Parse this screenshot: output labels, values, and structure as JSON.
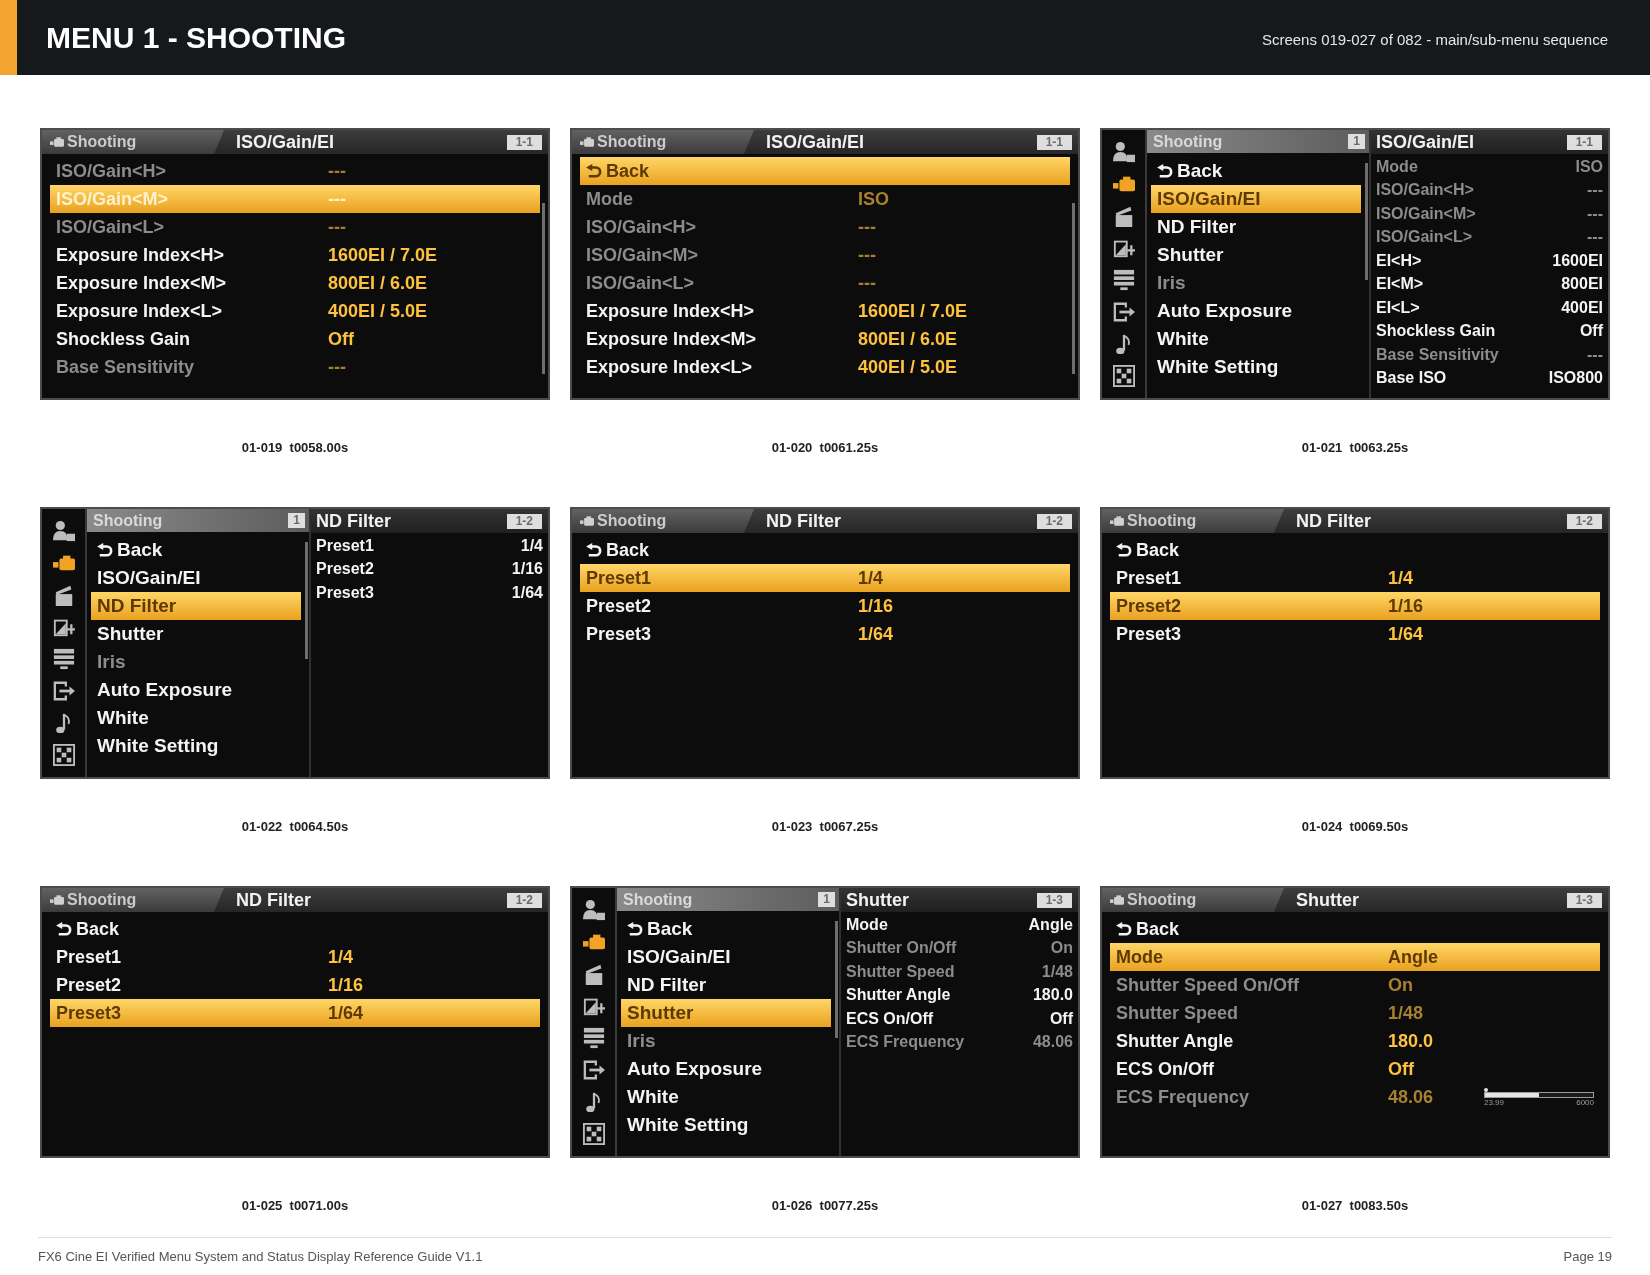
{
  "header": {
    "title": "MENU 1 - SHOOTING",
    "subtitle": "Screens 019-027 of 082 - main/sub-menu sequence"
  },
  "screens": [
    {
      "kind": "list",
      "tab": "Shooting",
      "title": "ISO/Gain/EI",
      "page": "1-1",
      "scrollbar": true,
      "rows": [
        {
          "kind": "setting",
          "label": "ISO/Gain<H>",
          "value": "---",
          "selected": false,
          "disabled": true
        },
        {
          "kind": "setting",
          "label": "ISO/Gain<M>",
          "value": "---",
          "selected": true,
          "disabled": true
        },
        {
          "kind": "setting",
          "label": "ISO/Gain<L>",
          "value": "---",
          "selected": false,
          "disabled": true
        },
        {
          "kind": "setting",
          "label": "Exposure Index<H>",
          "value": "1600EI / 7.0E",
          "selected": false,
          "disabled": false
        },
        {
          "kind": "setting",
          "label": "Exposure Index<M>",
          "value": "800EI / 6.0E",
          "selected": false,
          "disabled": false
        },
        {
          "kind": "setting",
          "label": "Exposure Index<L>",
          "value": "400EI / 5.0E",
          "selected": false,
          "disabled": false
        },
        {
          "kind": "setting",
          "label": "Shockless Gain",
          "value": "Off",
          "selected": false,
          "disabled": false
        },
        {
          "kind": "setting",
          "label": "Base Sensitivity",
          "value": "---",
          "selected": false,
          "disabled": true
        }
      ],
      "caption": "01-019  t0058.00s"
    },
    {
      "kind": "list",
      "tab": "Shooting",
      "title": "ISO/Gain/EI",
      "page": "1-1",
      "scrollbar": true,
      "rows": [
        {
          "kind": "back",
          "label": "Back",
          "selected": true,
          "disabled": false
        },
        {
          "kind": "setting",
          "label": "Mode",
          "value": "ISO",
          "selected": false,
          "disabled": true
        },
        {
          "kind": "setting",
          "label": "ISO/Gain<H>",
          "value": "---",
          "selected": false,
          "disabled": true
        },
        {
          "kind": "setting",
          "label": "ISO/Gain<M>",
          "value": "---",
          "selected": false,
          "disabled": true
        },
        {
          "kind": "setting",
          "label": "ISO/Gain<L>",
          "value": "---",
          "selected": false,
          "disabled": true
        },
        {
          "kind": "setting",
          "label": "Exposure Index<H>",
          "value": "1600EI / 7.0E",
          "selected": false,
          "disabled": false
        },
        {
          "kind": "setting",
          "label": "Exposure Index<M>",
          "value": "800EI / 6.0E",
          "selected": false,
          "disabled": false
        },
        {
          "kind": "setting",
          "label": "Exposure Index<L>",
          "value": "400EI / 5.0E",
          "selected": false,
          "disabled": false
        }
      ],
      "caption": "01-020  t0061.25s"
    },
    {
      "kind": "split",
      "menu": {
        "title": "Shooting",
        "page": "1",
        "scrollbar": true,
        "categories": [
          {
            "selected": false
          },
          {
            "selected": true
          },
          {
            "selected": false
          },
          {
            "selected": false
          },
          {
            "selected": false
          },
          {
            "selected": false
          },
          {
            "selected": false
          },
          {
            "selected": false
          }
        ],
        "items": [
          {
            "kind": "back",
            "label": "Back",
            "selected": false,
            "disabled": false
          },
          {
            "kind": "setting",
            "label": "ISO/Gain/EI",
            "selected": true,
            "disabled": false
          },
          {
            "kind": "setting",
            "label": "ND Filter",
            "selected": false,
            "disabled": false
          },
          {
            "kind": "setting",
            "label": "Shutter",
            "selected": false,
            "disabled": false
          },
          {
            "kind": "setting",
            "label": "Iris",
            "selected": false,
            "disabled": true
          },
          {
            "kind": "setting",
            "label": "Auto Exposure",
            "selected": false,
            "disabled": false
          },
          {
            "kind": "setting",
            "label": "White",
            "selected": false,
            "disabled": false
          },
          {
            "kind": "setting",
            "label": "White Setting",
            "selected": false,
            "disabled": false
          }
        ]
      },
      "pane": {
        "title": "ISO/Gain/EI",
        "page": "1-1",
        "rows": [
          {
            "kind": "setting",
            "label": "Mode",
            "value": "ISO",
            "selected": false,
            "disabled": true
          },
          {
            "kind": "setting",
            "label": "ISO/Gain<H>",
            "value": "---",
            "selected": false,
            "disabled": true
          },
          {
            "kind": "setting",
            "label": "ISO/Gain<M>",
            "value": "---",
            "selected": false,
            "disabled": true
          },
          {
            "kind": "setting",
            "label": "ISO/Gain<L>",
            "value": "---",
            "selected": false,
            "disabled": true
          },
          {
            "kind": "setting",
            "label": "EI<H>",
            "value": "1600EI",
            "selected": false,
            "disabled": false
          },
          {
            "kind": "setting",
            "label": "EI<M>",
            "value": "800EI",
            "selected": false,
            "disabled": false
          },
          {
            "kind": "setting",
            "label": "EI<L>",
            "value": "400EI",
            "selected": false,
            "disabled": false
          },
          {
            "kind": "setting",
            "label": "Shockless Gain",
            "value": "Off",
            "selected": false,
            "disabled": false
          },
          {
            "kind": "setting",
            "label": "Base Sensitivity",
            "value": "---",
            "selected": false,
            "disabled": true
          },
          {
            "kind": "setting",
            "label": "Base ISO",
            "value": "ISO800",
            "selected": false,
            "disabled": false
          }
        ]
      },
      "caption": "01-021  t0063.25s"
    },
    {
      "kind": "split",
      "menu": {
        "title": "Shooting",
        "page": "1",
        "scrollbar": true,
        "categories": [
          {
            "selected": false
          },
          {
            "selected": true
          },
          {
            "selected": false
          },
          {
            "selected": false
          },
          {
            "selected": false
          },
          {
            "selected": false
          },
          {
            "selected": false
          },
          {
            "selected": false
          }
        ],
        "items": [
          {
            "kind": "back",
            "label": "Back",
            "selected": false,
            "disabled": false
          },
          {
            "kind": "setting",
            "label": "ISO/Gain/EI",
            "selected": false,
            "disabled": false
          },
          {
            "kind": "setting",
            "label": "ND Filter",
            "selected": true,
            "disabled": false
          },
          {
            "kind": "setting",
            "label": "Shutter",
            "selected": false,
            "disabled": false
          },
          {
            "kind": "setting",
            "label": "Iris",
            "selected": false,
            "disabled": true
          },
          {
            "kind": "setting",
            "label": "Auto Exposure",
            "selected": false,
            "disabled": false
          },
          {
            "kind": "setting",
            "label": "White",
            "selected": false,
            "disabled": false
          },
          {
            "kind": "setting",
            "label": "White Setting",
            "selected": false,
            "disabled": false
          }
        ]
      },
      "pane": {
        "title": "ND Filter",
        "page": "1-2",
        "rows": [
          {
            "kind": "setting",
            "label": "Preset1",
            "value": "1/4",
            "selected": false,
            "disabled": false
          },
          {
            "kind": "setting",
            "label": "Preset2",
            "value": "1/16",
            "selected": false,
            "disabled": false
          },
          {
            "kind": "setting",
            "label": "Preset3",
            "value": "1/64",
            "selected": false,
            "disabled": false
          }
        ]
      },
      "caption": "01-022  t0064.50s"
    },
    {
      "kind": "list",
      "tab": "Shooting",
      "title": "ND Filter",
      "page": "1-2",
      "rows": [
        {
          "kind": "back",
          "label": "Back",
          "selected": false,
          "disabled": false
        },
        {
          "kind": "setting",
          "label": "Preset1",
          "value": "1/4",
          "selected": true,
          "disabled": false
        },
        {
          "kind": "setting",
          "label": "Preset2",
          "value": "1/16",
          "selected": false,
          "disabled": false
        },
        {
          "kind": "setting",
          "label": "Preset3",
          "value": "1/64",
          "selected": false,
          "disabled": false
        }
      ],
      "caption": "01-023  t0067.25s"
    },
    {
      "kind": "list",
      "tab": "Shooting",
      "title": "ND Filter",
      "page": "1-2",
      "rows": [
        {
          "kind": "back",
          "label": "Back",
          "selected": false,
          "disabled": false
        },
        {
          "kind": "setting",
          "label": "Preset1",
          "value": "1/4",
          "selected": false,
          "disabled": false
        },
        {
          "kind": "setting",
          "label": "Preset2",
          "value": "1/16",
          "selected": true,
          "disabled": false
        },
        {
          "kind": "setting",
          "label": "Preset3",
          "value": "1/64",
          "selected": false,
          "disabled": false
        }
      ],
      "caption": "01-024  t0069.50s"
    },
    {
      "kind": "list",
      "tab": "Shooting",
      "title": "ND Filter",
      "page": "1-2",
      "rows": [
        {
          "kind": "back",
          "label": "Back",
          "selected": false,
          "disabled": false
        },
        {
          "kind": "setting",
          "label": "Preset1",
          "value": "1/4",
          "selected": false,
          "disabled": false
        },
        {
          "kind": "setting",
          "label": "Preset2",
          "value": "1/16",
          "selected": false,
          "disabled": false
        },
        {
          "kind": "setting",
          "label": "Preset3",
          "value": "1/64",
          "selected": true,
          "disabled": false
        }
      ],
      "caption": "01-025  t0071.00s"
    },
    {
      "kind": "split",
      "menu": {
        "title": "Shooting",
        "page": "1",
        "scrollbar": true,
        "categories": [
          {
            "selected": false
          },
          {
            "selected": true
          },
          {
            "selected": false
          },
          {
            "selected": false
          },
          {
            "selected": false
          },
          {
            "selected": false
          },
          {
            "selected": false
          },
          {
            "selected": false
          }
        ],
        "items": [
          {
            "kind": "back",
            "label": "Back",
            "selected": false,
            "disabled": false
          },
          {
            "kind": "setting",
            "label": "ISO/Gain/EI",
            "selected": false,
            "disabled": false
          },
          {
            "kind": "setting",
            "label": "ND Filter",
            "selected": false,
            "disabled": false
          },
          {
            "kind": "setting",
            "label": "Shutter",
            "selected": true,
            "disabled": false
          },
          {
            "kind": "setting",
            "label": "Iris",
            "selected": false,
            "disabled": true
          },
          {
            "kind": "setting",
            "label": "Auto Exposure",
            "selected": false,
            "disabled": false
          },
          {
            "kind": "setting",
            "label": "White",
            "selected": false,
            "disabled": false
          },
          {
            "kind": "setting",
            "label": "White Setting",
            "selected": false,
            "disabled": false
          }
        ]
      },
      "pane": {
        "title": "Shutter",
        "page": "1-3",
        "rows": [
          {
            "kind": "setting",
            "label": "Mode",
            "value": "Angle",
            "selected": false,
            "disabled": false
          },
          {
            "kind": "setting",
            "label": "Shutter On/Off",
            "value": "On",
            "selected": false,
            "disabled": true
          },
          {
            "kind": "setting",
            "label": "Shutter Speed",
            "value": "1/48",
            "selected": false,
            "disabled": true
          },
          {
            "kind": "setting",
            "label": "Shutter Angle",
            "value": "180.0",
            "selected": false,
            "disabled": false
          },
          {
            "kind": "setting",
            "label": "ECS On/Off",
            "value": "Off",
            "selected": false,
            "disabled": false
          },
          {
            "kind": "setting",
            "label": "ECS Frequency",
            "value": "48.06",
            "selected": false,
            "disabled": true
          }
        ]
      },
      "caption": "01-026  t0077.25s"
    },
    {
      "kind": "list",
      "tab": "Shooting",
      "title": "Shutter",
      "page": "1-3",
      "rows": [
        {
          "kind": "back",
          "label": "Back",
          "selected": false,
          "disabled": false
        },
        {
          "kind": "setting",
          "label": "Mode",
          "value": "Angle",
          "selected": true,
          "disabled": false
        },
        {
          "kind": "setting",
          "label": "Shutter Speed On/Off",
          "value": "On",
          "selected": false,
          "disabled": true
        },
        {
          "kind": "setting",
          "label": "Shutter Speed",
          "value": "1/48",
          "selected": false,
          "disabled": true
        },
        {
          "kind": "setting",
          "label": "Shutter Angle",
          "value": "180.0",
          "selected": false,
          "disabled": false
        },
        {
          "kind": "setting",
          "label": "ECS On/Off",
          "value": "Off",
          "selected": false,
          "disabled": false
        },
        {
          "kind": "slider",
          "label": "ECS Frequency",
          "value": "48.06",
          "selected": false,
          "disabled": true,
          "level": 0.5,
          "min": "23.99",
          "max": "6000"
        }
      ],
      "caption": "01-027  t0083.50s"
    }
  ],
  "footer": {
    "text": "FX6 Cine EI Verified Menu System and Status Display Reference Guide V1.1",
    "page": "Page 19"
  }
}
